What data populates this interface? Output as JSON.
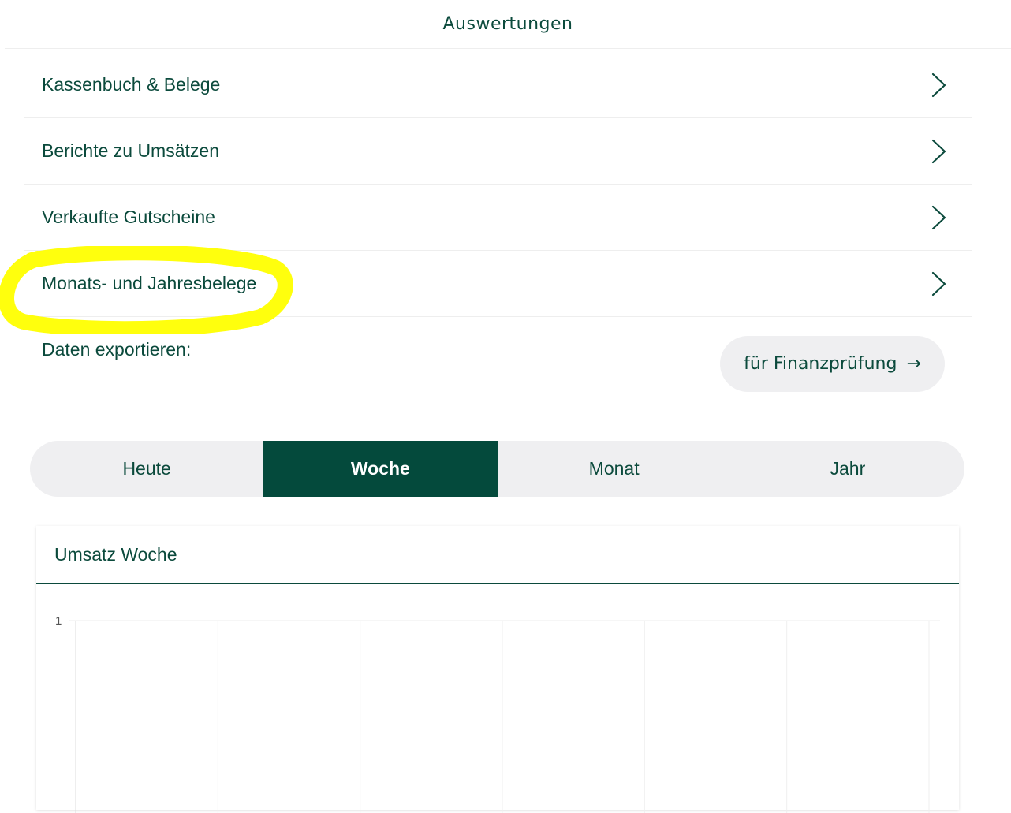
{
  "header": {
    "title": "Auswertungen"
  },
  "menu": {
    "items": [
      {
        "label": "Kassenbuch & Belege"
      },
      {
        "label": "Berichte zu Umsätzen"
      },
      {
        "label": "Verkaufte Gutscheine"
      },
      {
        "label": "Monats- und Jahresbelege"
      }
    ]
  },
  "export": {
    "label": "Daten exportieren:",
    "button_label": "für Finanzprüfung",
    "button_arrow": "→"
  },
  "tabs": [
    {
      "label": "Heute",
      "active": false
    },
    {
      "label": "Woche",
      "active": true
    },
    {
      "label": "Monat",
      "active": false
    },
    {
      "label": "Jahr",
      "active": false
    }
  ],
  "card": {
    "title": "Umsatz Woche"
  },
  "chart_data": {
    "type": "line",
    "title": "Umsatz Woche",
    "yticks": [
      "1"
    ],
    "vertical_gridlines": 7,
    "series": []
  },
  "colors": {
    "primary": "#044a3c",
    "text": "#0b4a3c",
    "pill_background": "#efeff1",
    "highlight": "#ffff00",
    "divider": "#eeeeee"
  }
}
